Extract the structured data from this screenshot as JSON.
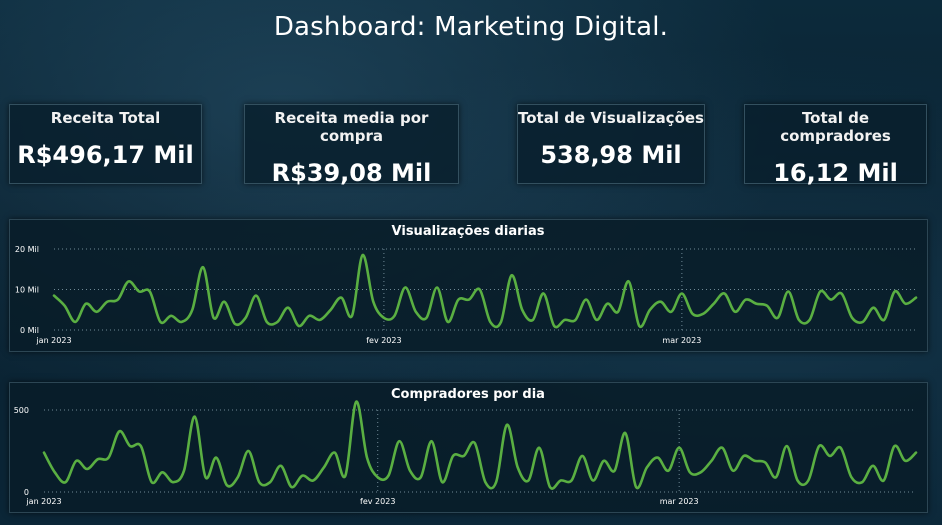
{
  "page": {
    "title": "Dashboard: Marketing Digital."
  },
  "kpis": [
    {
      "label": "Receita Total",
      "value": "R$496,17 Mil"
    },
    {
      "label": "Receita media por compra",
      "value": "R$39,08 Mil"
    },
    {
      "label": "Total de Visualizações",
      "value": "538,98 Mil"
    },
    {
      "label": "Total de compradores",
      "value": "16,12 Mil"
    }
  ],
  "colors": {
    "line": "#5aaf42",
    "grid": "#6f8995",
    "text": "#ffffff"
  },
  "chart_data": [
    {
      "type": "line",
      "title": "Visualizações diarias",
      "x_tick_labels": [
        "jan 2023",
        "fev 2023",
        "mar 2023"
      ],
      "y_tick_labels": [
        "20 Mil",
        "10 Mil",
        "0 Mil"
      ],
      "ylim": [
        0,
        20000
      ],
      "x_start": "2023-01-01",
      "series": [
        {
          "values": [
            8500,
            6000,
            2000,
            6500,
            4500,
            7000,
            7500,
            12000,
            9500,
            9500,
            2000,
            3500,
            2000,
            5000,
            15500,
            3000,
            7000,
            1500,
            3000,
            8500,
            2000,
            2000,
            5500,
            1000,
            3500,
            2500,
            5000,
            8000,
            3500,
            18500,
            7000,
            3000,
            3500,
            10500,
            4500,
            3000,
            10500,
            2000,
            7500,
            7500,
            10000,
            2000,
            2000,
            13500,
            5000,
            2500,
            9000,
            1000,
            2500,
            2500,
            7500,
            2500,
            6500,
            4500,
            12000,
            1000,
            5000,
            7000,
            4500,
            9000,
            4000,
            4000,
            6500,
            9000,
            4500,
            7500,
            6500,
            6000,
            3000,
            9500,
            2500,
            2500,
            9500,
            7500,
            9000,
            3000,
            2000,
            5500,
            2500,
            9500,
            6500,
            8000
          ]
        }
      ],
      "grid": true
    },
    {
      "type": "line",
      "title": "Compradores por dia",
      "x_tick_labels": [
        "jan 2023",
        "fev 2023",
        "mar 2023"
      ],
      "y_tick_labels": [
        "500",
        "0"
      ],
      "ylim": [
        0,
        500
      ],
      "x_start": "2023-01-01",
      "series": [
        {
          "values": [
            240,
            120,
            60,
            190,
            140,
            200,
            210,
            370,
            280,
            280,
            60,
            120,
            60,
            130,
            460,
            90,
            210,
            40,
            90,
            250,
            60,
            60,
            160,
            30,
            100,
            70,
            150,
            240,
            100,
            550,
            210,
            90,
            100,
            310,
            130,
            90,
            310,
            60,
            220,
            220,
            300,
            60,
            60,
            410,
            150,
            70,
            270,
            30,
            70,
            70,
            220,
            70,
            190,
            130,
            360,
            30,
            150,
            210,
            130,
            270,
            120,
            120,
            190,
            270,
            130,
            220,
            190,
            180,
            90,
            280,
            70,
            70,
            280,
            220,
            270,
            90,
            60,
            160,
            70,
            280,
            190,
            240
          ]
        }
      ],
      "grid": true
    }
  ]
}
